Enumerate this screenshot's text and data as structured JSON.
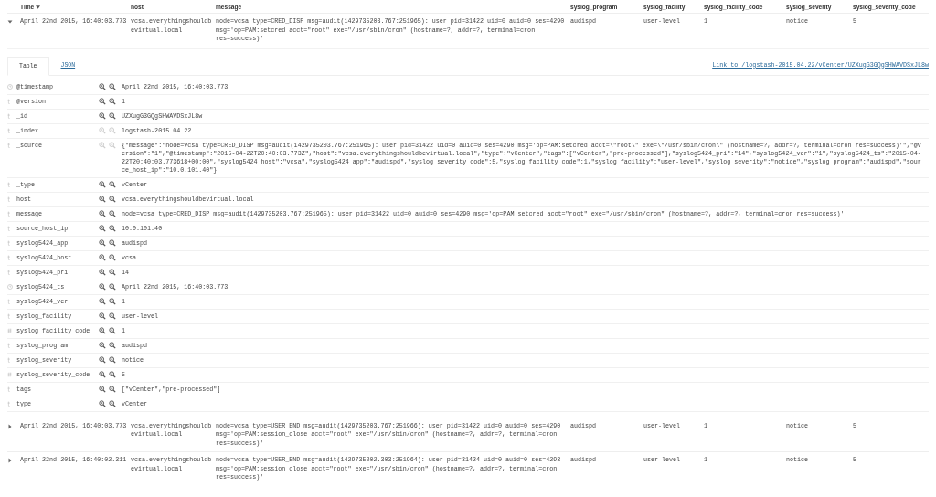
{
  "columns": [
    {
      "label": "Time",
      "sorted": true
    },
    {
      "label": "host",
      "sorted": false
    },
    {
      "label": "message",
      "sorted": false
    },
    {
      "label": "syslog_program",
      "sorted": false
    },
    {
      "label": "syslog_facility",
      "sorted": false
    },
    {
      "label": "syslog_facility_code",
      "sorted": false
    },
    {
      "label": "syslog_severity",
      "sorted": false
    },
    {
      "label": "syslog_severity_code",
      "sorted": false
    }
  ],
  "rows": [
    {
      "expanded": true,
      "cells": [
        "April 22nd 2015, 16:40:03.773",
        "vcsa.everythingshouldbevirtual.local",
        "node=vcsa type=CRED_DISP msg=audit(1429735203.767:251965): user pid=31422 uid=0 auid=0 ses=4290 msg='op=PAM:setcred acct=\"root\" exe=\"/usr/sbin/cron\" (hostname=?, addr=?, terminal=cron res=success)'",
        "audispd",
        "user-level",
        "1",
        "notice",
        "5"
      ],
      "details": {
        "tabs": [
          {
            "label": "Table",
            "selected": true
          },
          {
            "label": "JSON",
            "selected": false
          }
        ],
        "link": "Link to /logstash-2015.04.22/vCenter/UZXugG3GQgSHWAVDSxJL8w",
        "fields": [
          {
            "kind": "date",
            "name": "@timestamp",
            "filter_disabled": false,
            "value": "April 22nd 2015, 16:40:03.773"
          },
          {
            "kind": "string",
            "name": "@version",
            "filter_disabled": false,
            "value": "1"
          },
          {
            "kind": "string",
            "name": "_id",
            "filter_disabled": false,
            "value": "UZXugG3GQgSHWAVDSxJL8w"
          },
          {
            "kind": "string",
            "name": "_index",
            "filter_disabled": true,
            "value": "logstash-2015.04.22"
          },
          {
            "kind": "string",
            "name": "_source",
            "filter_disabled": true,
            "value": "{\"message\":\"node=vcsa type=CRED_DISP msg=audit(1429735203.767:251965): user pid=31422 uid=0 auid=0 ses=4290 msg='op=PAM:setcred acct=\\\"root\\\" exe=\\\"/usr/sbin/cron\\\" (hostname=?, addr=?, terminal=cron res=success)'\",\"@version\":\"1\",\"@timestamp\":\"2015-04-22T20:40:03.773Z\",\"host\":\"vcsa.everythingshouldbevirtual.local\",\"type\":\"vCenter\",\"tags\":[\"vCenter\",\"pre-processed\"],\"syslog5424_pri\":\"14\",\"syslog5424_ver\":\"1\",\"syslog5424_ts\":\"2015-04-22T20:40:03.773618+00:00\",\"syslog5424_host\":\"vcsa\",\"syslog5424_app\":\"audispd\",\"syslog_severity_code\":5,\"syslog_facility_code\":1,\"syslog_facility\":\"user-level\",\"syslog_severity\":\"notice\",\"syslog_program\":\"audispd\",\"source_host_ip\":\"10.0.101.40\"}"
          },
          {
            "kind": "string",
            "name": "_type",
            "filter_disabled": false,
            "value": "vCenter"
          },
          {
            "kind": "string",
            "name": "host",
            "filter_disabled": false,
            "value": "vcsa.everythingshouldbevirtual.local"
          },
          {
            "kind": "string",
            "name": "message",
            "filter_disabled": false,
            "value": "node=vcsa type=CRED_DISP msg=audit(1429735203.767:251965): user pid=31422 uid=0 auid=0 ses=4290 msg='op=PAM:setcred acct=\"root\" exe=\"/usr/sbin/cron\" (hostname=?, addr=?, terminal=cron res=success)'"
          },
          {
            "kind": "string",
            "name": "source_host_ip",
            "filter_disabled": false,
            "value": "10.0.101.40"
          },
          {
            "kind": "string",
            "name": "syslog5424_app",
            "filter_disabled": false,
            "value": "audispd"
          },
          {
            "kind": "string",
            "name": "syslog5424_host",
            "filter_disabled": false,
            "value": "vcsa"
          },
          {
            "kind": "string",
            "name": "syslog5424_pri",
            "filter_disabled": false,
            "value": "14"
          },
          {
            "kind": "date",
            "name": "syslog5424_ts",
            "filter_disabled": false,
            "value": "April 22nd 2015, 16:40:03.773"
          },
          {
            "kind": "string",
            "name": "syslog5424_ver",
            "filter_disabled": false,
            "value": "1"
          },
          {
            "kind": "string",
            "name": "syslog_facility",
            "filter_disabled": false,
            "value": "user-level"
          },
          {
            "kind": "number",
            "name": "syslog_facility_code",
            "filter_disabled": false,
            "value": "1"
          },
          {
            "kind": "string",
            "name": "syslog_program",
            "filter_disabled": false,
            "value": "audispd"
          },
          {
            "kind": "string",
            "name": "syslog_severity",
            "filter_disabled": false,
            "value": "notice"
          },
          {
            "kind": "number",
            "name": "syslog_severity_code",
            "filter_disabled": false,
            "value": "5"
          },
          {
            "kind": "string",
            "name": "tags",
            "filter_disabled": false,
            "value": "[\"vCenter\",\"pre-processed\"]"
          },
          {
            "kind": "string",
            "name": "type",
            "filter_disabled": false,
            "value": "vCenter"
          }
        ]
      }
    },
    {
      "expanded": false,
      "cells": [
        "April 22nd 2015, 16:40:03.773",
        "vcsa.everythingshouldbevirtual.local",
        "node=vcsa type=USER_END msg=audit(1429735203.767:251966): user pid=31422 uid=0 auid=0 ses=4290 msg='op=PAM:session_close acct=\"root\" exe=\"/usr/sbin/cron\" (hostname=?, addr=?, terminal=cron res=success)'",
        "audispd",
        "user-level",
        "1",
        "notice",
        "5"
      ]
    },
    {
      "expanded": false,
      "cells": [
        "April 22nd 2015, 16:40:02.311",
        "vcsa.everythingshouldbevirtual.local",
        "node=vcsa type=USER_END msg=audit(1429735202.303:251964): user pid=31424 uid=0 auid=0 ses=4293 msg='op=PAM:session_close acct=\"root\" exe=\"/usr/sbin/cron\" (hostname=?, addr=?, terminal=cron res=success)'",
        "audispd",
        "user-level",
        "1",
        "notice",
        "5"
      ]
    }
  ]
}
